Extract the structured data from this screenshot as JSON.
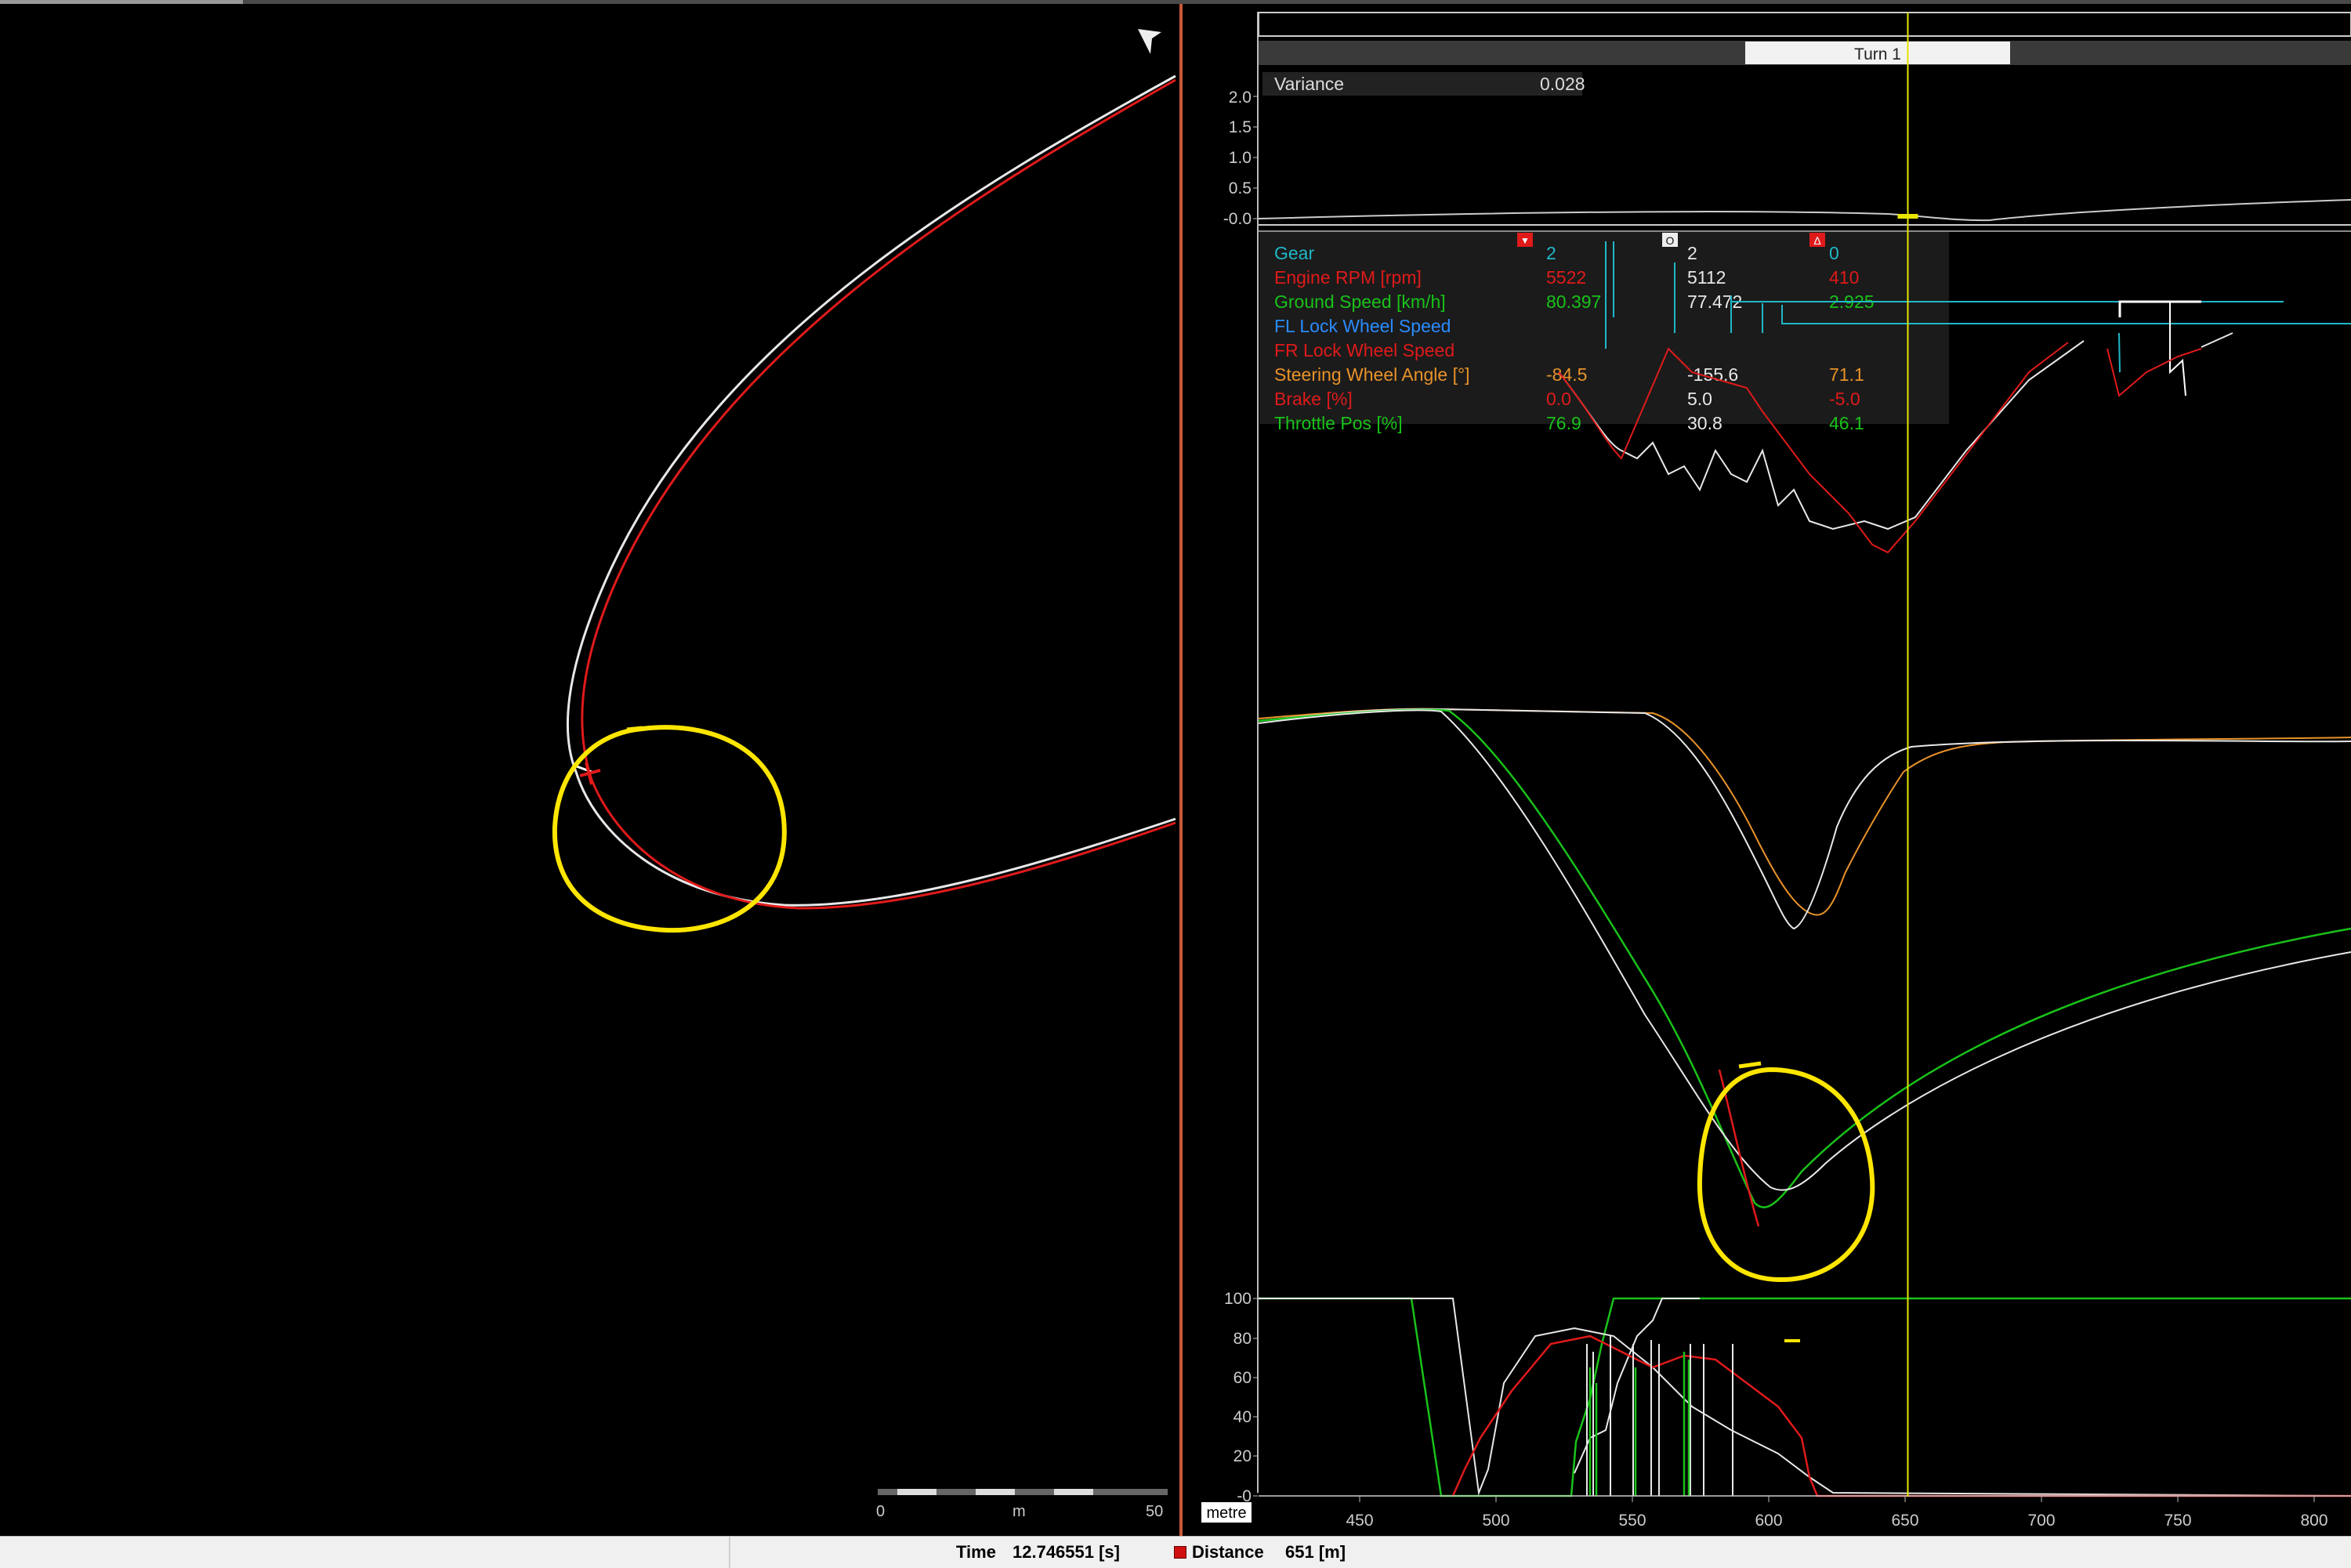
{
  "map": {
    "scale_bar": {
      "start": "0",
      "unit": "m",
      "end": "50"
    }
  },
  "section_bar": {
    "label": "Turn 1"
  },
  "variance": {
    "label": "Variance",
    "value": "0.028",
    "y_ticks": [
      "2.0",
      "1.5",
      "1.0",
      "0.5",
      "-0.0"
    ]
  },
  "legend": {
    "header_icons": [
      "red-car-icon",
      "white-car-icon",
      "delta-icon"
    ],
    "rows": [
      {
        "label": "Gear",
        "a": "2",
        "b": "2",
        "d": "0",
        "color": "#1fb8c8"
      },
      {
        "label": "Engine RPM [rpm]",
        "a": "5522",
        "b": "5112",
        "d": "410",
        "color": "#e01a1a"
      },
      {
        "label": "Ground Speed [km/h]",
        "a": "80.397",
        "b": "77.472",
        "d": "2.925",
        "color": "#19c219"
      },
      {
        "label": "FL Lock Wheel Speed",
        "a": "",
        "b": "",
        "d": "",
        "color": "#2a8cff"
      },
      {
        "label": "FR Lock Wheel Speed",
        "a": "",
        "b": "",
        "d": "",
        "color": "#e01a1a"
      },
      {
        "label": "Steering Wheel Angle [°]",
        "a": "-84.5",
        "b": "-155.6",
        "d": "71.1",
        "color": "#e8922a"
      },
      {
        "label": "Brake [%]",
        "a": "0.0",
        "b": "5.0",
        "d": "-5.0",
        "color": "#e01a1a"
      },
      {
        "label": "Throttle Pos [%]",
        "a": "76.9",
        "b": "30.8",
        "d": "46.1",
        "color": "#19c219"
      }
    ]
  },
  "bottom_chart": {
    "y_ticks": [
      "100",
      "80",
      "60",
      "40",
      "20",
      "-0"
    ]
  },
  "x_axis": {
    "unit": "metre",
    "ticks": [
      "450",
      "500",
      "550",
      "600",
      "650",
      "700",
      "750",
      "800"
    ]
  },
  "cursor_distance_m": 651,
  "status": {
    "time_label": "Time",
    "time_value": "12.746551 [s]",
    "distance_label": "Distance",
    "distance_value": "651 [m]"
  },
  "colors": {
    "red_lap": "#e01a1a",
    "white_lap": "#e8e8e8",
    "cursor": "#e6e600",
    "annotation": "#ffe600"
  }
}
